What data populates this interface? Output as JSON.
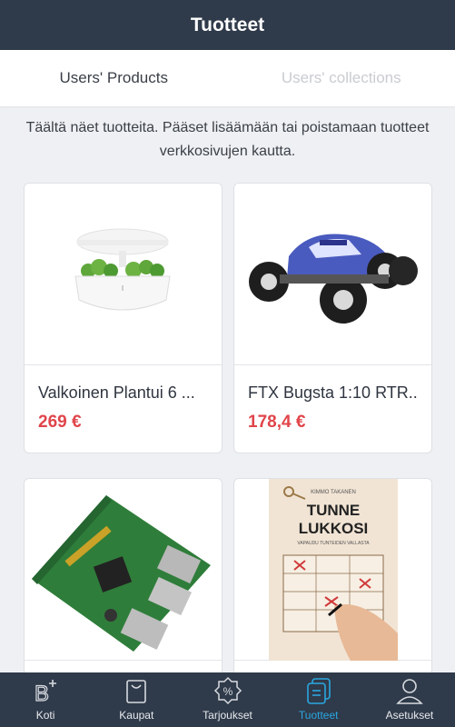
{
  "header": {
    "title": "Tuotteet"
  },
  "tabs": [
    {
      "label": "Users' Products",
      "active": true
    },
    {
      "label": "Users' collections",
      "active": false
    }
  ],
  "intro": "Täältä näet tuotteita. Pääset lisäämään tai poistamaan tuotteet verkkosivujen kautta.",
  "products": [
    {
      "name": "Valkoinen Plantui 6 ...",
      "price": "269 €",
      "image": "white-planter-with-herbs"
    },
    {
      "name": "FTX Bugsta 1:10 RTR..",
      "price": "178,4 €",
      "image": "rc-monster-truck"
    },
    {
      "name": "",
      "price": "",
      "image": "raspberry-pi-board"
    },
    {
      "name": "",
      "price": "",
      "image": "book-tunne-lukkosi"
    }
  ],
  "book_cover": {
    "author": "KIMMO TAKANEN",
    "title_line1": "TUNNE",
    "title_line2": "LUKKOSI",
    "subtitle": "VAPAUDU TUNTEIDEN VALLASTA"
  },
  "bottom_nav": [
    {
      "label": "Koti",
      "icon": "home-b-plus-icon",
      "active": false
    },
    {
      "label": "Kaupat",
      "icon": "bag-icon",
      "active": false
    },
    {
      "label": "Tarjoukset",
      "icon": "percent-badge-icon",
      "active": false
    },
    {
      "label": "Tuotteet",
      "icon": "products-icon",
      "active": true
    },
    {
      "label": "Asetukset",
      "icon": "user-icon",
      "active": false
    }
  ],
  "colors": {
    "header_bg": "#2f3a4a",
    "price": "#e0454b",
    "active_nav": "#2aa7e0",
    "page_bg": "#eef0f3"
  }
}
